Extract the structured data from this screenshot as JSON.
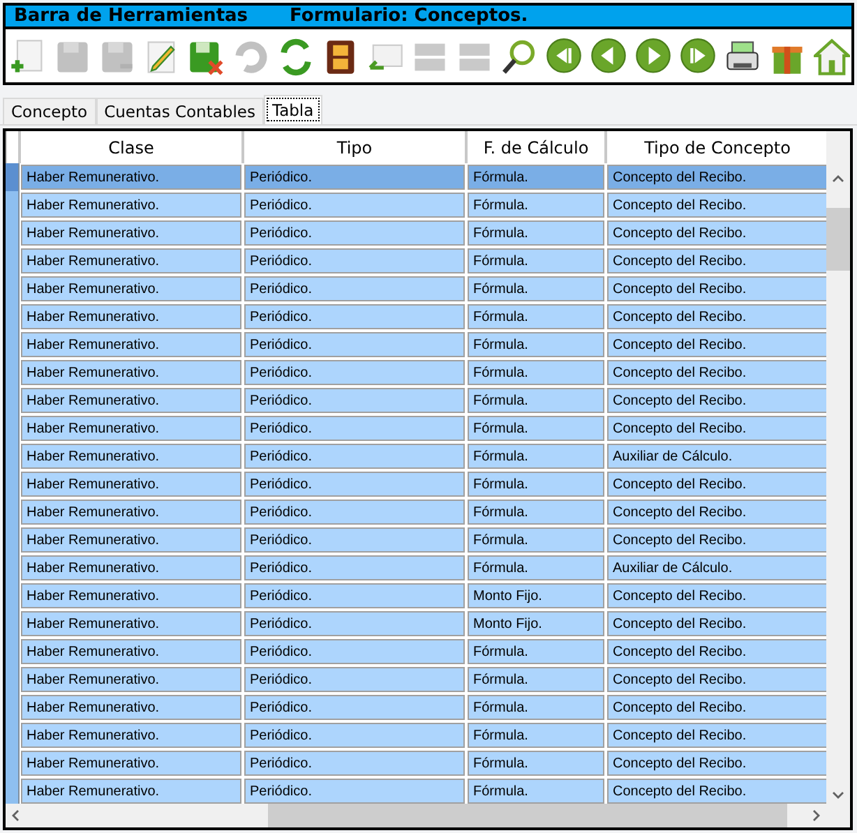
{
  "title_bar": {
    "title": "Barra de Herramientas",
    "form": "Formulario: Conceptos."
  },
  "toolbar": [
    {
      "kind": "add",
      "disabled": false
    },
    {
      "kind": "save",
      "disabled": true
    },
    {
      "kind": "save-as",
      "disabled": true
    },
    {
      "kind": "edit",
      "disabled": false
    },
    {
      "kind": "discard",
      "disabled": false
    },
    {
      "kind": "undo",
      "disabled": true
    },
    {
      "kind": "refresh",
      "disabled": false
    },
    {
      "kind": "film",
      "disabled": false
    },
    {
      "kind": "import",
      "disabled": false
    },
    {
      "kind": "rows",
      "disabled": true
    },
    {
      "kind": "rows",
      "disabled": true
    },
    {
      "kind": "search",
      "disabled": false
    },
    {
      "kind": "first",
      "disabled": false
    },
    {
      "kind": "prev",
      "disabled": false
    },
    {
      "kind": "next",
      "disabled": false
    },
    {
      "kind": "last",
      "disabled": false
    },
    {
      "kind": "print",
      "disabled": false
    },
    {
      "kind": "gift",
      "disabled": false
    },
    {
      "kind": "home",
      "disabled": false
    }
  ],
  "tabs": [
    {
      "label": "Concepto",
      "selected": false
    },
    {
      "label": "Cuentas Contables",
      "selected": false
    },
    {
      "label": "Tabla",
      "selected": true
    }
  ],
  "table": {
    "columns": [
      "Clase",
      "Tipo",
      "F. de Cálculo",
      "Tipo de Concepto"
    ],
    "rows": [
      {
        "selected": true,
        "cells": [
          "Haber Remunerativo.",
          "Periódico.",
          "Fórmula.",
          "Concepto del Recibo."
        ]
      },
      {
        "selected": false,
        "cells": [
          "Haber Remunerativo.",
          "Periódico.",
          "Fórmula.",
          "Concepto del Recibo."
        ]
      },
      {
        "selected": false,
        "cells": [
          "Haber Remunerativo.",
          "Periódico.",
          "Fórmula.",
          "Concepto del Recibo."
        ]
      },
      {
        "selected": false,
        "cells": [
          "Haber Remunerativo.",
          "Periódico.",
          "Fórmula.",
          "Concepto del Recibo."
        ]
      },
      {
        "selected": false,
        "cells": [
          "Haber Remunerativo.",
          "Periódico.",
          "Fórmula.",
          "Concepto del Recibo."
        ]
      },
      {
        "selected": false,
        "cells": [
          "Haber Remunerativo.",
          "Periódico.",
          "Fórmula.",
          "Concepto del Recibo."
        ]
      },
      {
        "selected": false,
        "cells": [
          "Haber Remunerativo.",
          "Periódico.",
          "Fórmula.",
          "Concepto del Recibo."
        ]
      },
      {
        "selected": false,
        "cells": [
          "Haber Remunerativo.",
          "Periódico.",
          "Fórmula.",
          "Concepto del Recibo."
        ]
      },
      {
        "selected": false,
        "cells": [
          "Haber Remunerativo.",
          "Periódico.",
          "Fórmula.",
          "Concepto del Recibo."
        ]
      },
      {
        "selected": false,
        "cells": [
          "Haber Remunerativo.",
          "Periódico.",
          "Fórmula.",
          "Concepto del Recibo."
        ]
      },
      {
        "selected": false,
        "cells": [
          "Haber Remunerativo.",
          "Periódico.",
          "Fórmula.",
          "Auxiliar de Cálculo."
        ]
      },
      {
        "selected": false,
        "cells": [
          "Haber Remunerativo.",
          "Periódico.",
          "Fórmula.",
          "Concepto del Recibo."
        ]
      },
      {
        "selected": false,
        "cells": [
          "Haber Remunerativo.",
          "Periódico.",
          "Fórmula.",
          "Concepto del Recibo."
        ]
      },
      {
        "selected": false,
        "cells": [
          "Haber Remunerativo.",
          "Periódico.",
          "Fórmula.",
          "Concepto del Recibo."
        ]
      },
      {
        "selected": false,
        "cells": [
          "Haber Remunerativo.",
          "Periódico.",
          "Fórmula.",
          "Auxiliar de Cálculo."
        ]
      },
      {
        "selected": false,
        "cells": [
          "Haber Remunerativo.",
          "Periódico.",
          "Monto Fijo.",
          "Concepto del Recibo."
        ]
      },
      {
        "selected": false,
        "cells": [
          "Haber Remunerativo.",
          "Periódico.",
          "Monto Fijo.",
          "Concepto del Recibo."
        ]
      },
      {
        "selected": false,
        "cells": [
          "Haber Remunerativo.",
          "Periódico.",
          "Fórmula.",
          "Concepto del Recibo."
        ]
      },
      {
        "selected": false,
        "cells": [
          "Haber Remunerativo.",
          "Periódico.",
          "Fórmula.",
          "Concepto del Recibo."
        ]
      },
      {
        "selected": false,
        "cells": [
          "Haber Remunerativo.",
          "Periódico.",
          "Fórmula.",
          "Concepto del Recibo."
        ]
      },
      {
        "selected": false,
        "cells": [
          "Haber Remunerativo.",
          "Periódico.",
          "Fórmula.",
          "Concepto del Recibo."
        ]
      },
      {
        "selected": false,
        "cells": [
          "Haber Remunerativo.",
          "Periódico.",
          "Fórmula.",
          "Concepto del Recibo."
        ]
      },
      {
        "selected": false,
        "cells": [
          "Haber Remunerativo.",
          "Periódico.",
          "Fórmula.",
          "Concepto del Recibo."
        ]
      }
    ]
  }
}
